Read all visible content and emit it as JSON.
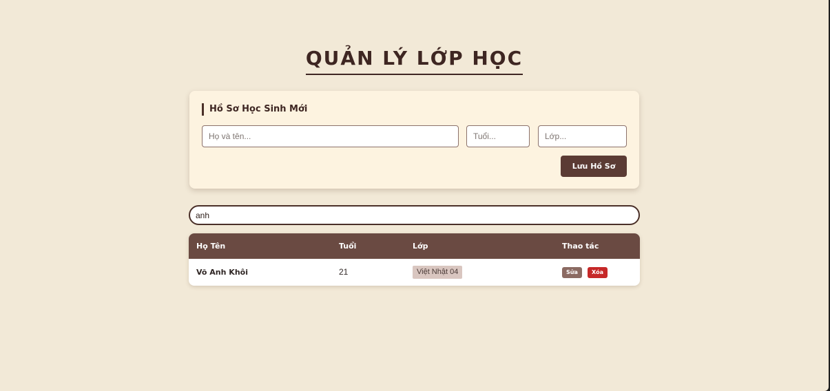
{
  "page": {
    "title": "QUẢN LÝ LỚP HỌC"
  },
  "form": {
    "heading": "Hồ Sơ Học Sinh Mới",
    "name_placeholder": "Họ và tên...",
    "age_placeholder": "Tuổi...",
    "class_placeholder": "Lớp...",
    "save_label": "Lưu Hồ Sơ"
  },
  "search": {
    "value": "anh"
  },
  "table": {
    "headers": [
      "Họ Tên",
      "Tuổi",
      "Lớp",
      "Thao tác"
    ],
    "rows": [
      {
        "name": "Võ Anh Khôi",
        "age": "21",
        "class": "Việt Nhật 04",
        "edit_label": "Sửa",
        "delete_label": "Xóa"
      }
    ]
  },
  "colors": {
    "background": "#f2e9d7",
    "card": "#fdf3e0",
    "primary": "#5b3b34",
    "table_header": "#6a4a42",
    "danger": "#c62828"
  }
}
